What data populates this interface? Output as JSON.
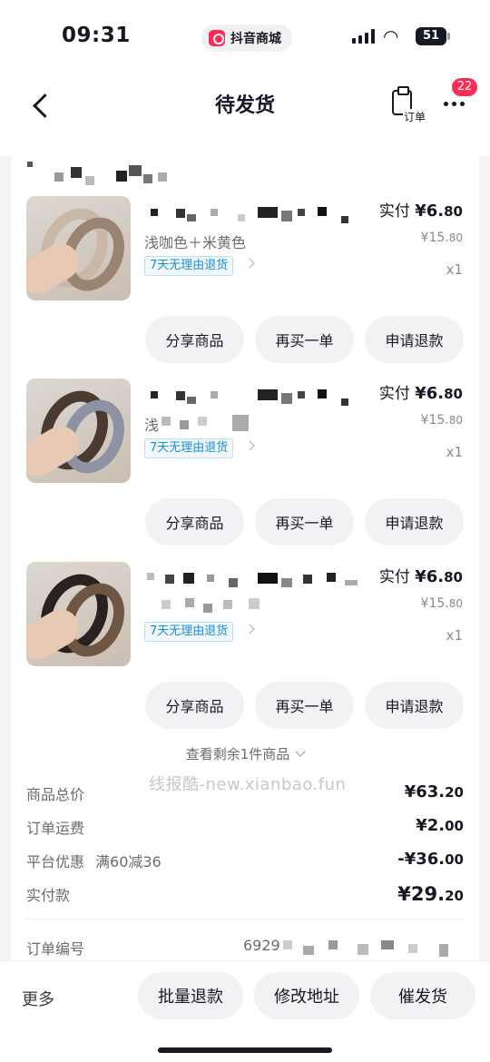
{
  "status_bar": {
    "time": "09:31",
    "app_name": "抖音商城",
    "battery": "51"
  },
  "header": {
    "title": "待发货",
    "order_label": "订单",
    "more_badge": "22"
  },
  "items": [
    {
      "variant": "浅咖色＋米黄色",
      "return_tag": "7天无理由退货",
      "paid_label": "实付",
      "paid_int": "¥6.",
      "paid_dec": "80",
      "orig_int": "¥15.",
      "orig_dec": "80",
      "qty": "x1",
      "bands": [
        "#c9b8a6",
        "#9a8371"
      ],
      "buttons": [
        "分享商品",
        "再买一单",
        "申请退款"
      ]
    },
    {
      "variant": "浅",
      "return_tag": "7天无理由退货",
      "paid_label": "实付",
      "paid_int": "¥6.",
      "paid_dec": "80",
      "orig_int": "¥15.",
      "orig_dec": "80",
      "qty": "x1",
      "bands": [
        "#4a3a31",
        "#8d93a3"
      ],
      "buttons": [
        "分享商品",
        "再买一单",
        "申请退款"
      ]
    },
    {
      "variant": "",
      "return_tag": "7天无理由退货",
      "paid_label": "实付",
      "paid_int": "¥6.",
      "paid_dec": "80",
      "orig_int": "¥15.",
      "orig_dec": "80",
      "qty": "x1",
      "bands": [
        "#2a2220",
        "#6e5544"
      ],
      "buttons": [
        "分享商品",
        "再买一单",
        "申请退款"
      ]
    }
  ],
  "expand_label": "查看剩余1件商品",
  "watermark": "线报酷-new.xianbao.fun",
  "summary": {
    "goods_total": {
      "label": "商品总价",
      "int": "¥63.",
      "dec": "20"
    },
    "shipping": {
      "label": "订单运费",
      "int": "¥2.",
      "dec": "00"
    },
    "discount": {
      "label": "平台优惠",
      "sub": "满60减36",
      "int": "-¥36.",
      "dec": "00"
    },
    "paid": {
      "label": "实付款",
      "int": "¥29.",
      "dec": "20"
    },
    "order_no": {
      "label": "订单编号",
      "value": "6929"
    }
  },
  "bottom": {
    "more": "更多",
    "buttons": [
      "批量退款",
      "修改地址",
      "催发货"
    ]
  }
}
